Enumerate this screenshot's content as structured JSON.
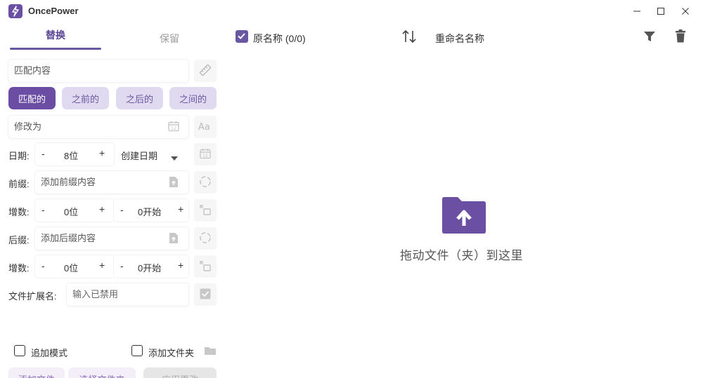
{
  "app": {
    "title": "OncePower"
  },
  "tabs": {
    "replace": "替换",
    "keep": "保留"
  },
  "match": {
    "placeholder": "匹配内容"
  },
  "modes": [
    "匹配的",
    "之前的",
    "之后的",
    "之间的"
  ],
  "modify": {
    "placeholder": "修改为"
  },
  "date": {
    "label": "日期:",
    "minus": "-",
    "value": "8位",
    "plus": "+",
    "type": "创建日期"
  },
  "prefix": {
    "label": "前缀:",
    "placeholder": "添加前缀内容"
  },
  "increment1": {
    "label": "增数:",
    "minus": "-",
    "digits": "0位",
    "plus": "+",
    "minus2": "-",
    "start": "0开始",
    "plus2": "+"
  },
  "suffix": {
    "label": "后缀:",
    "placeholder": "添加后缀内容"
  },
  "increment2": {
    "label": "增数:",
    "minus": "-",
    "digits": "0位",
    "plus": "+",
    "minus2": "-",
    "start": "0开始",
    "plus2": "+"
  },
  "extension": {
    "label": "文件扩展名:",
    "placeholder": "输入已禁用"
  },
  "options": {
    "append_mode": "追加模式",
    "add_folder": "添加文件夹"
  },
  "bottom": {
    "add_files": "添加文件",
    "select_folder": "选择文件夹",
    "apply": "应用更改"
  },
  "list_header": {
    "original_name": "原名称 (0/0)",
    "rename_name": "重命名名称"
  },
  "drop_zone": {
    "text": "拖动文件（夹）到这里"
  },
  "colors": {
    "accent": "#6b4ea3",
    "accent_light": "#e0daf0",
    "folder": "#6a4fa3"
  }
}
